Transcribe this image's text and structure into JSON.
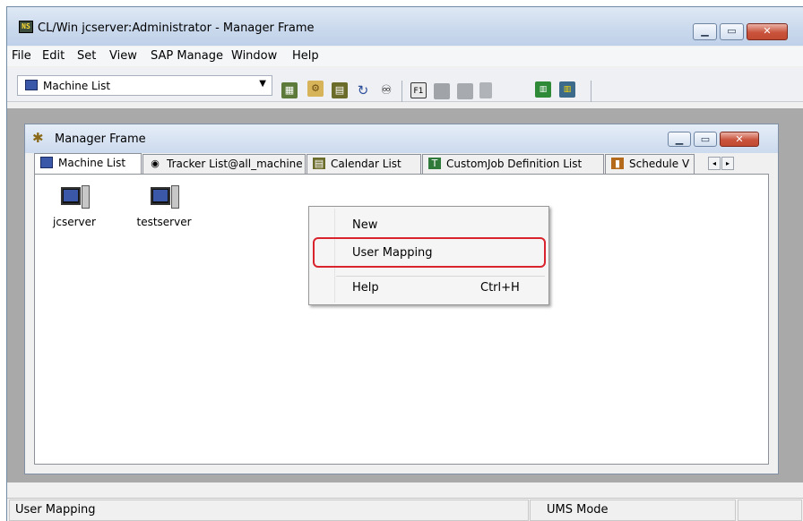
{
  "window": {
    "title": "CL/Win jcserver:Administrator - Manager Frame",
    "app_icon": "NS"
  },
  "menubar": {
    "items": [
      "File",
      "Edit",
      "Set",
      "View",
      "SAP Manage",
      "Window",
      "Help"
    ]
  },
  "toolbar": {
    "combo_value": "Machine List"
  },
  "child": {
    "title": "Manager Frame",
    "tabs": [
      {
        "label": "Machine List",
        "active": true
      },
      {
        "label": "Tracker List@all_machine"
      },
      {
        "label": "Calendar List"
      },
      {
        "label": "CustomJob Definition List"
      },
      {
        "label": "Schedule V"
      }
    ],
    "machines": [
      {
        "label": "jcserver"
      },
      {
        "label": "testserver"
      }
    ]
  },
  "context_menu": {
    "items": [
      {
        "label": "New",
        "shortcut": ""
      },
      {
        "label": "User Mapping",
        "shortcut": ""
      },
      {
        "label": "Help",
        "shortcut": "Ctrl+H"
      }
    ],
    "highlighted": "User Mapping"
  },
  "statusbar": {
    "message": "User Mapping",
    "mode": "UMS Mode"
  },
  "colors": {
    "highlight_border": "#d9232d",
    "mdi_background": "#a9a9a9"
  }
}
